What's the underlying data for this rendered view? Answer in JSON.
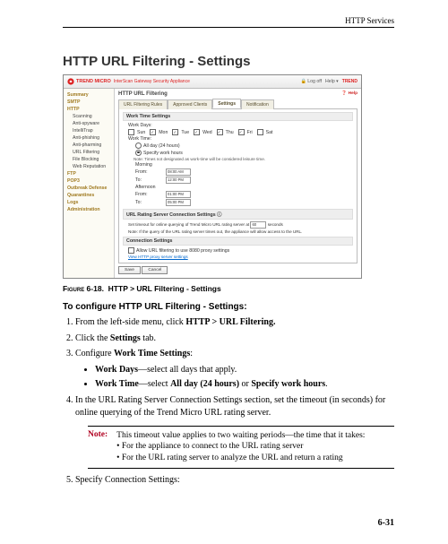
{
  "header": {
    "section": "HTTP Services"
  },
  "title": "HTTP URL Filtering - Settings",
  "shot": {
    "brand": "TREND MICRO",
    "brand_sub": "InterScan Gateway Security Appliance",
    "toolbar": {
      "logoff": "Log off",
      "help": "Help ▾",
      "logo": "TREND"
    },
    "page_title": "HTTP URL Filtering",
    "help": "❓ Help",
    "tabs": [
      "URL Filtering Rules",
      "Approved Clients",
      "Settings",
      "Notification"
    ],
    "sidebar": [
      {
        "t": "Summary",
        "c": "cat"
      },
      {
        "t": "SMTP",
        "c": "cat"
      },
      {
        "t": "HTTP",
        "c": "cat"
      },
      {
        "t": "Scanning",
        "c": "sub"
      },
      {
        "t": "Anti-spyware",
        "c": "sub"
      },
      {
        "t": "IntelliTrap",
        "c": "sub"
      },
      {
        "t": "Anti-phishing",
        "c": "sub"
      },
      {
        "t": "Anti-pharming",
        "c": "sub"
      },
      {
        "t": "URL Filtering",
        "c": "sub"
      },
      {
        "t": "File Blocking",
        "c": "sub"
      },
      {
        "t": "Web Reputation",
        "c": "sub"
      },
      {
        "t": "FTP",
        "c": "cat"
      },
      {
        "t": "POP3",
        "c": "cat"
      },
      {
        "t": "Outbreak Defense",
        "c": "cat"
      },
      {
        "t": "Quarantines",
        "c": "cat"
      },
      {
        "t": "Logs",
        "c": "cat"
      },
      {
        "t": "Administration",
        "c": "cat"
      }
    ],
    "wt_header": "Work Time Settings",
    "work_days_label": "Work Days:",
    "days": [
      "Sun",
      "Mon",
      "Tue",
      "Wed",
      "Thu",
      "Fri",
      "Sat"
    ],
    "work_time_label": "Work Time:",
    "opt_all": "All day (24 hours)",
    "opt_spec": "Specify work hours",
    "wt_note": "Note: Times not designated as work-time will be considered leisure time.",
    "col_morning": "Morning",
    "col_afternoon": "Afternoon",
    "from": "From:",
    "to": "To:",
    "t1": "08:00 AM",
    "t2": "12:00 PM",
    "t3": "01:00 PM",
    "t4": "05:00 PM",
    "rating_header": "URL Rating Server Connection Settings ⓘ",
    "rating_text1": "Set timeout for online querying of Trend Micro URL rating server at",
    "rating_text2": "Note: If the query of the URL rating server times out, the appliance will allow access to the URL.",
    "sec_field": "60",
    "sec_lbl": "seconds",
    "conn_header": "Connection Settings",
    "conn_opt": "Allow URL filtering to use 8080 proxy settings",
    "view_link": "View HTTP proxy server settings",
    "save": "Save",
    "cancel": "Cancel"
  },
  "figure_caption": {
    "num": "Figure 6-18.",
    "text": "HTTP > URL Filtering - Settings"
  },
  "subhead": "To configure HTTP URL Filtering - Settings:",
  "steps": {
    "s1a": "From the left-side menu, click ",
    "s1b": "HTTP > URL Filtering.",
    "s2a": "Click the ",
    "s2b": "Settings",
    "s2c": " tab.",
    "s3a": "Configure ",
    "s3b": "Work Time Settings",
    "s3c": ":",
    "b1a": "Work Days",
    "b1b": "—select all days that apply.",
    "b2a": "Work Time",
    "b2b": "—select ",
    "b2c": "All day (24 hours)",
    "b2d": " or ",
    "b2e": "Specify work hours",
    "b2f": ".",
    "s4": "In the URL Rating Server Connection Settings section, set the timeout (in seconds) for online querying of the Trend Micro URL rating server."
  },
  "note": {
    "label": "Note:",
    "body": "This timeout value applies to two waiting periods—the time that it takes:",
    "l1": "• For the appliance to connect to the URL rating server",
    "l2": "• For the URL rating server to analyze the URL and return a rating"
  },
  "step5": "Specify Connection Settings:",
  "footer": "6-31"
}
